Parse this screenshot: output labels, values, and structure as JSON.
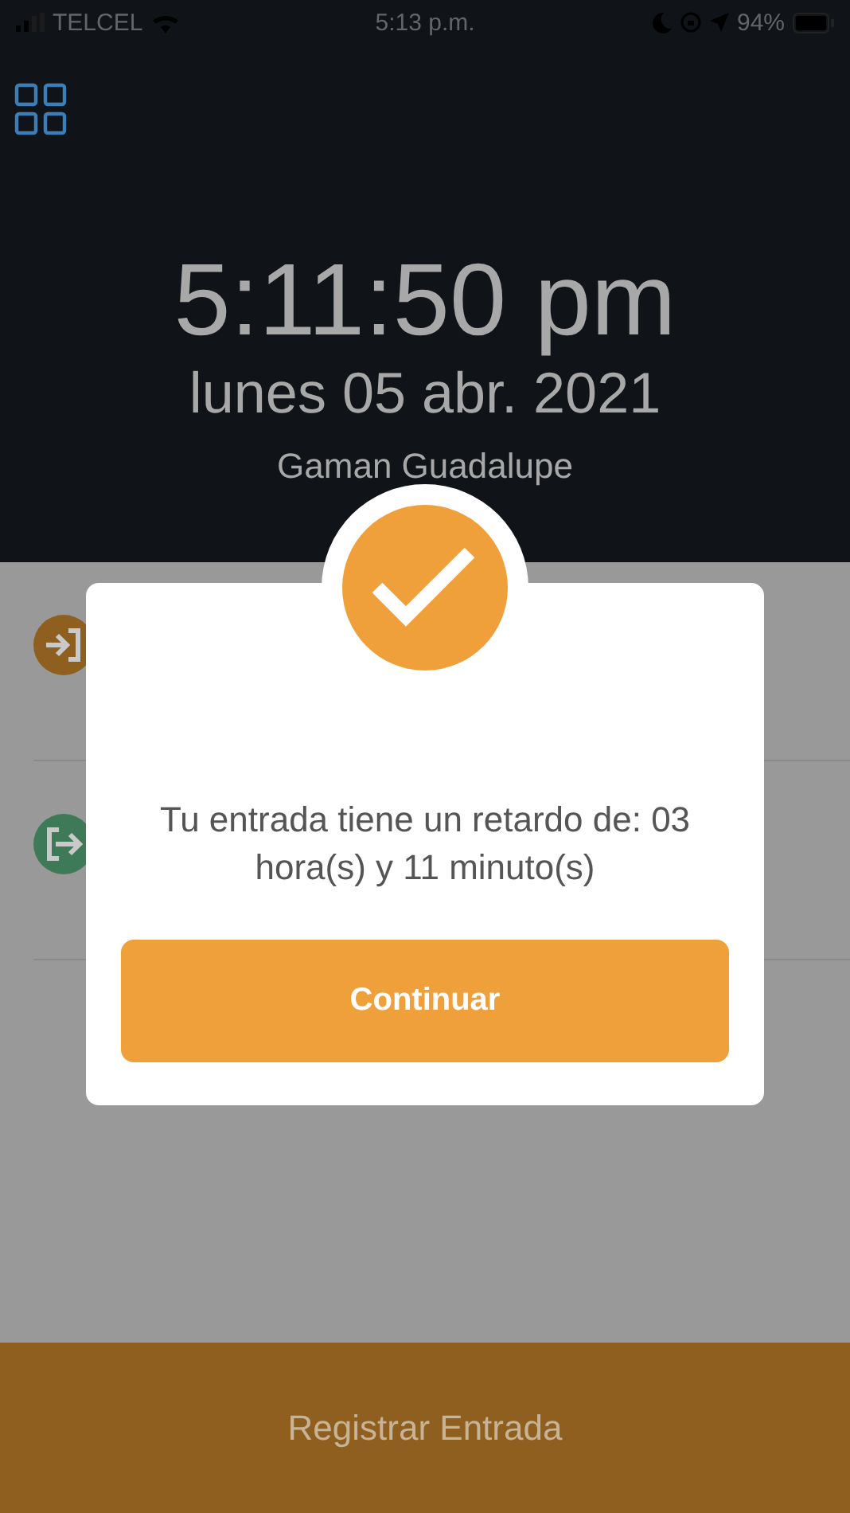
{
  "status_bar": {
    "carrier": "TELCEL",
    "time": "5:13 p.m.",
    "battery": "94%"
  },
  "header": {
    "clock": "5:11:50 pm",
    "date": "lunes 05 abr. 2021",
    "user": "Gaman Guadalupe"
  },
  "records": [
    {
      "kind": "entry",
      "color": "#8f5f20"
    },
    {
      "kind": "exit",
      "color": "#3f7a58"
    }
  ],
  "dialog": {
    "message": "Tu entrada tiene un retardo de: 03 hora(s) y 11 minuto(s)",
    "button": "Continuar"
  },
  "bottom_button": "Registrar Entrada"
}
